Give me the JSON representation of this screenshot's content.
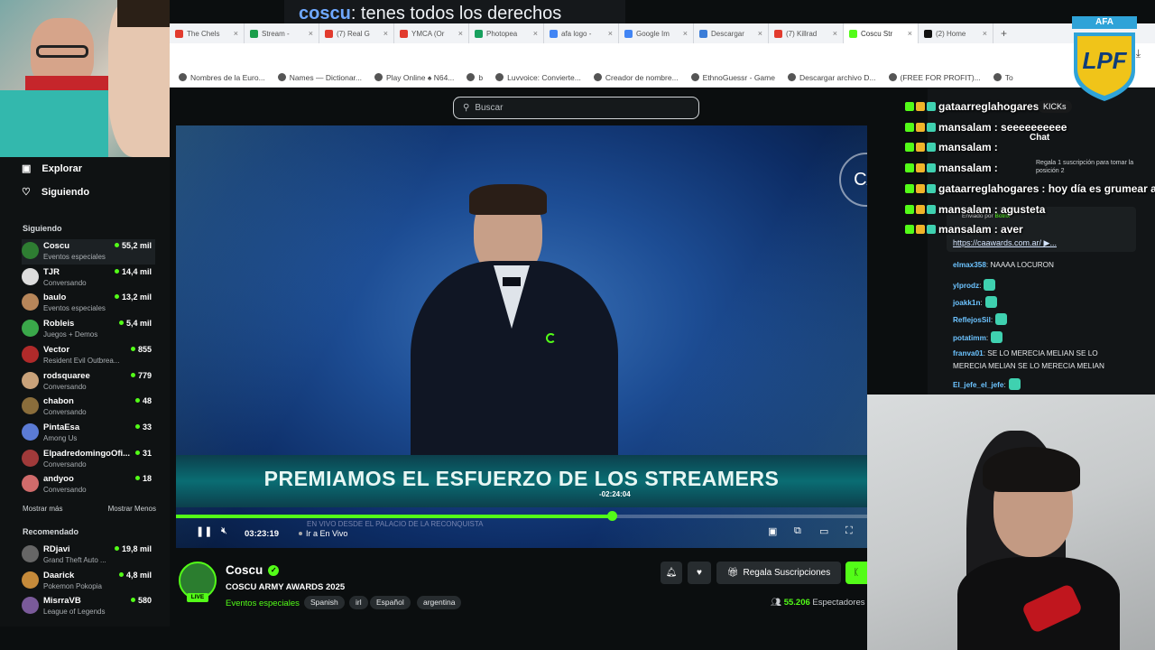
{
  "caption": {
    "user": "coscu",
    "text": ": tenes todos los derechos"
  },
  "browser": {
    "tabs": [
      {
        "label": "The Chels",
        "color": "#e23b2e"
      },
      {
        "label": "Stream -",
        "color": "#1b9e4b"
      },
      {
        "label": "(7) Real G",
        "color": "#e23b2e"
      },
      {
        "label": "YMCA (Or",
        "color": "#e23b2e"
      },
      {
        "label": "Photopea",
        "color": "#18a05e"
      },
      {
        "label": "afa logo -",
        "color": "#4285f4"
      },
      {
        "label": "Google Im",
        "color": "#4285f4"
      },
      {
        "label": "Descargar",
        "color": "#3b7dd8"
      },
      {
        "label": "(7) Killrad",
        "color": "#e23b2e"
      },
      {
        "label": "Coscu Str",
        "color": "#53fc18",
        "active": true
      },
      {
        "label": "(2) Home",
        "color": "#111111"
      }
    ],
    "new_tab": "+",
    "bookmarks": [
      "Nombres de la Euro...",
      "Names — Dictionar...",
      "Play Online ♠ N64...",
      "b",
      "Luvvoice: Convierte...",
      "Creador de nombre...",
      "EthnoGuessr - Game",
      "Descargar archivo D...",
      "(FREE FOR PROFIT)...",
      "To"
    ]
  },
  "site": {
    "search_placeholder": "Buscar"
  },
  "sidebar": {
    "nav": [
      {
        "label": "Explorar"
      },
      {
        "label": "Siguiendo"
      }
    ],
    "following_title": "Siguiendo",
    "following": [
      {
        "name": "Coscu",
        "category": "Eventos especiales",
        "viewers": "55,2 mil",
        "color": "#2e7d32"
      },
      {
        "name": "TJR",
        "category": "Conversando",
        "viewers": "14,4 mil",
        "color": "#dddddd"
      },
      {
        "name": "baulo",
        "category": "Eventos especiales",
        "viewers": "13,2 mil",
        "color": "#b7865a"
      },
      {
        "name": "Robleis",
        "category": "Juegos + Demos",
        "viewers": "5,4 mil",
        "color": "#3aa84a"
      },
      {
        "name": "Vector",
        "category": "Resident Evil Outbrea...",
        "viewers": "855",
        "color": "#b02a2a"
      },
      {
        "name": "rodsquaree",
        "category": "Conversando",
        "viewers": "779",
        "color": "#c9a27a"
      },
      {
        "name": "chabon",
        "category": "Conversando",
        "viewers": "48",
        "color": "#8a6d3b"
      },
      {
        "name": "PintaEsa",
        "category": "Among Us",
        "viewers": "33",
        "color": "#5b7bd5"
      },
      {
        "name": "ElpadredomingoOfi...",
        "category": "Conversando",
        "viewers": "31",
        "color": "#a03a3a"
      },
      {
        "name": "andyoo",
        "category": "Conversando",
        "viewers": "18",
        "color": "#d06b6b"
      }
    ],
    "show_more": "Mostrar más",
    "show_less": "Mostrar Menos",
    "recommended_title": "Recomendado",
    "recommended": [
      {
        "name": "RDjavi",
        "category": "Grand Theft Auto ...",
        "viewers": "19,8 mil",
        "color": "#666666"
      },
      {
        "name": "Daarick",
        "category": "Pokemon Pokopia",
        "viewers": "4,8 mil",
        "color": "#c58a3a"
      },
      {
        "name": "MisrraVB",
        "category": "League of Legends",
        "viewers": "580",
        "color": "#7a5a9a"
      }
    ]
  },
  "player": {
    "banner": "PREMIAMOS EL ESFUERZO DE LOS STREAMERS",
    "banner_sub": "EN VIVO DESDE EL PALACIO DE LA RECONQUISTA",
    "progress": 0.63,
    "seek_tooltip": "-02:24:04",
    "time": "03:23:19",
    "go_live": "Ir a En Vivo"
  },
  "stream": {
    "name": "Coscu",
    "title": "COSCU ARMY AWARDS 2025",
    "live_badge": "LIVE",
    "category": "Eventos especiales",
    "tags": [
      "Spanish",
      "irl",
      "Español",
      "argentina"
    ],
    "gift_button": "Regala Suscripciones",
    "viewers_count": "55.206",
    "viewers_label": "Espectadores"
  },
  "chat": {
    "title": "Chat",
    "gift_notice": "Regala 1 suscripción para tomar la posición 2",
    "pinned_label": "Enviado por",
    "pinned_bot": "Botrix",
    "pinned_link": "https://caawards.com.ar/ ▶...",
    "messages": [
      {
        "user": "elmax358",
        "text": ": NAAAA LOCURON"
      },
      {
        "user": "ylprodz",
        "text": ":"
      },
      {
        "user": "joakk1n",
        "text": ":"
      },
      {
        "user": "ReflejosSil",
        "text": ":"
      },
      {
        "user": "potatimm",
        "text": ":"
      },
      {
        "user": "franva01",
        "text": ": SE LO MERECIA MELIAN SE LO"
      },
      {
        "user": "",
        "text": "MERECIA MELIAN SE LO MERECIA MELIAN"
      },
      {
        "user": "El_jefe_el_jefe",
        "text": ":"
      }
    ]
  },
  "overlay_chat": [
    {
      "user": "gataarreglahogares",
      "text": ""
    },
    {
      "user": "mansalam",
      "text": ": seeeeeeeeee"
    },
    {
      "user": "mansalam",
      "text": ":"
    },
    {
      "user": "mansalam",
      "text": ":"
    },
    {
      "user": "gataarreglahogares",
      "text": ": hoy día es grumear a"
    },
    {
      "user": "mansalam",
      "text": ": agusteta"
    },
    {
      "user": "mansalam",
      "text": ": aver"
    }
  ],
  "kicks_badge": "KICKs",
  "afa_logo": {
    "top": "AFA",
    "letters": "LPF"
  }
}
